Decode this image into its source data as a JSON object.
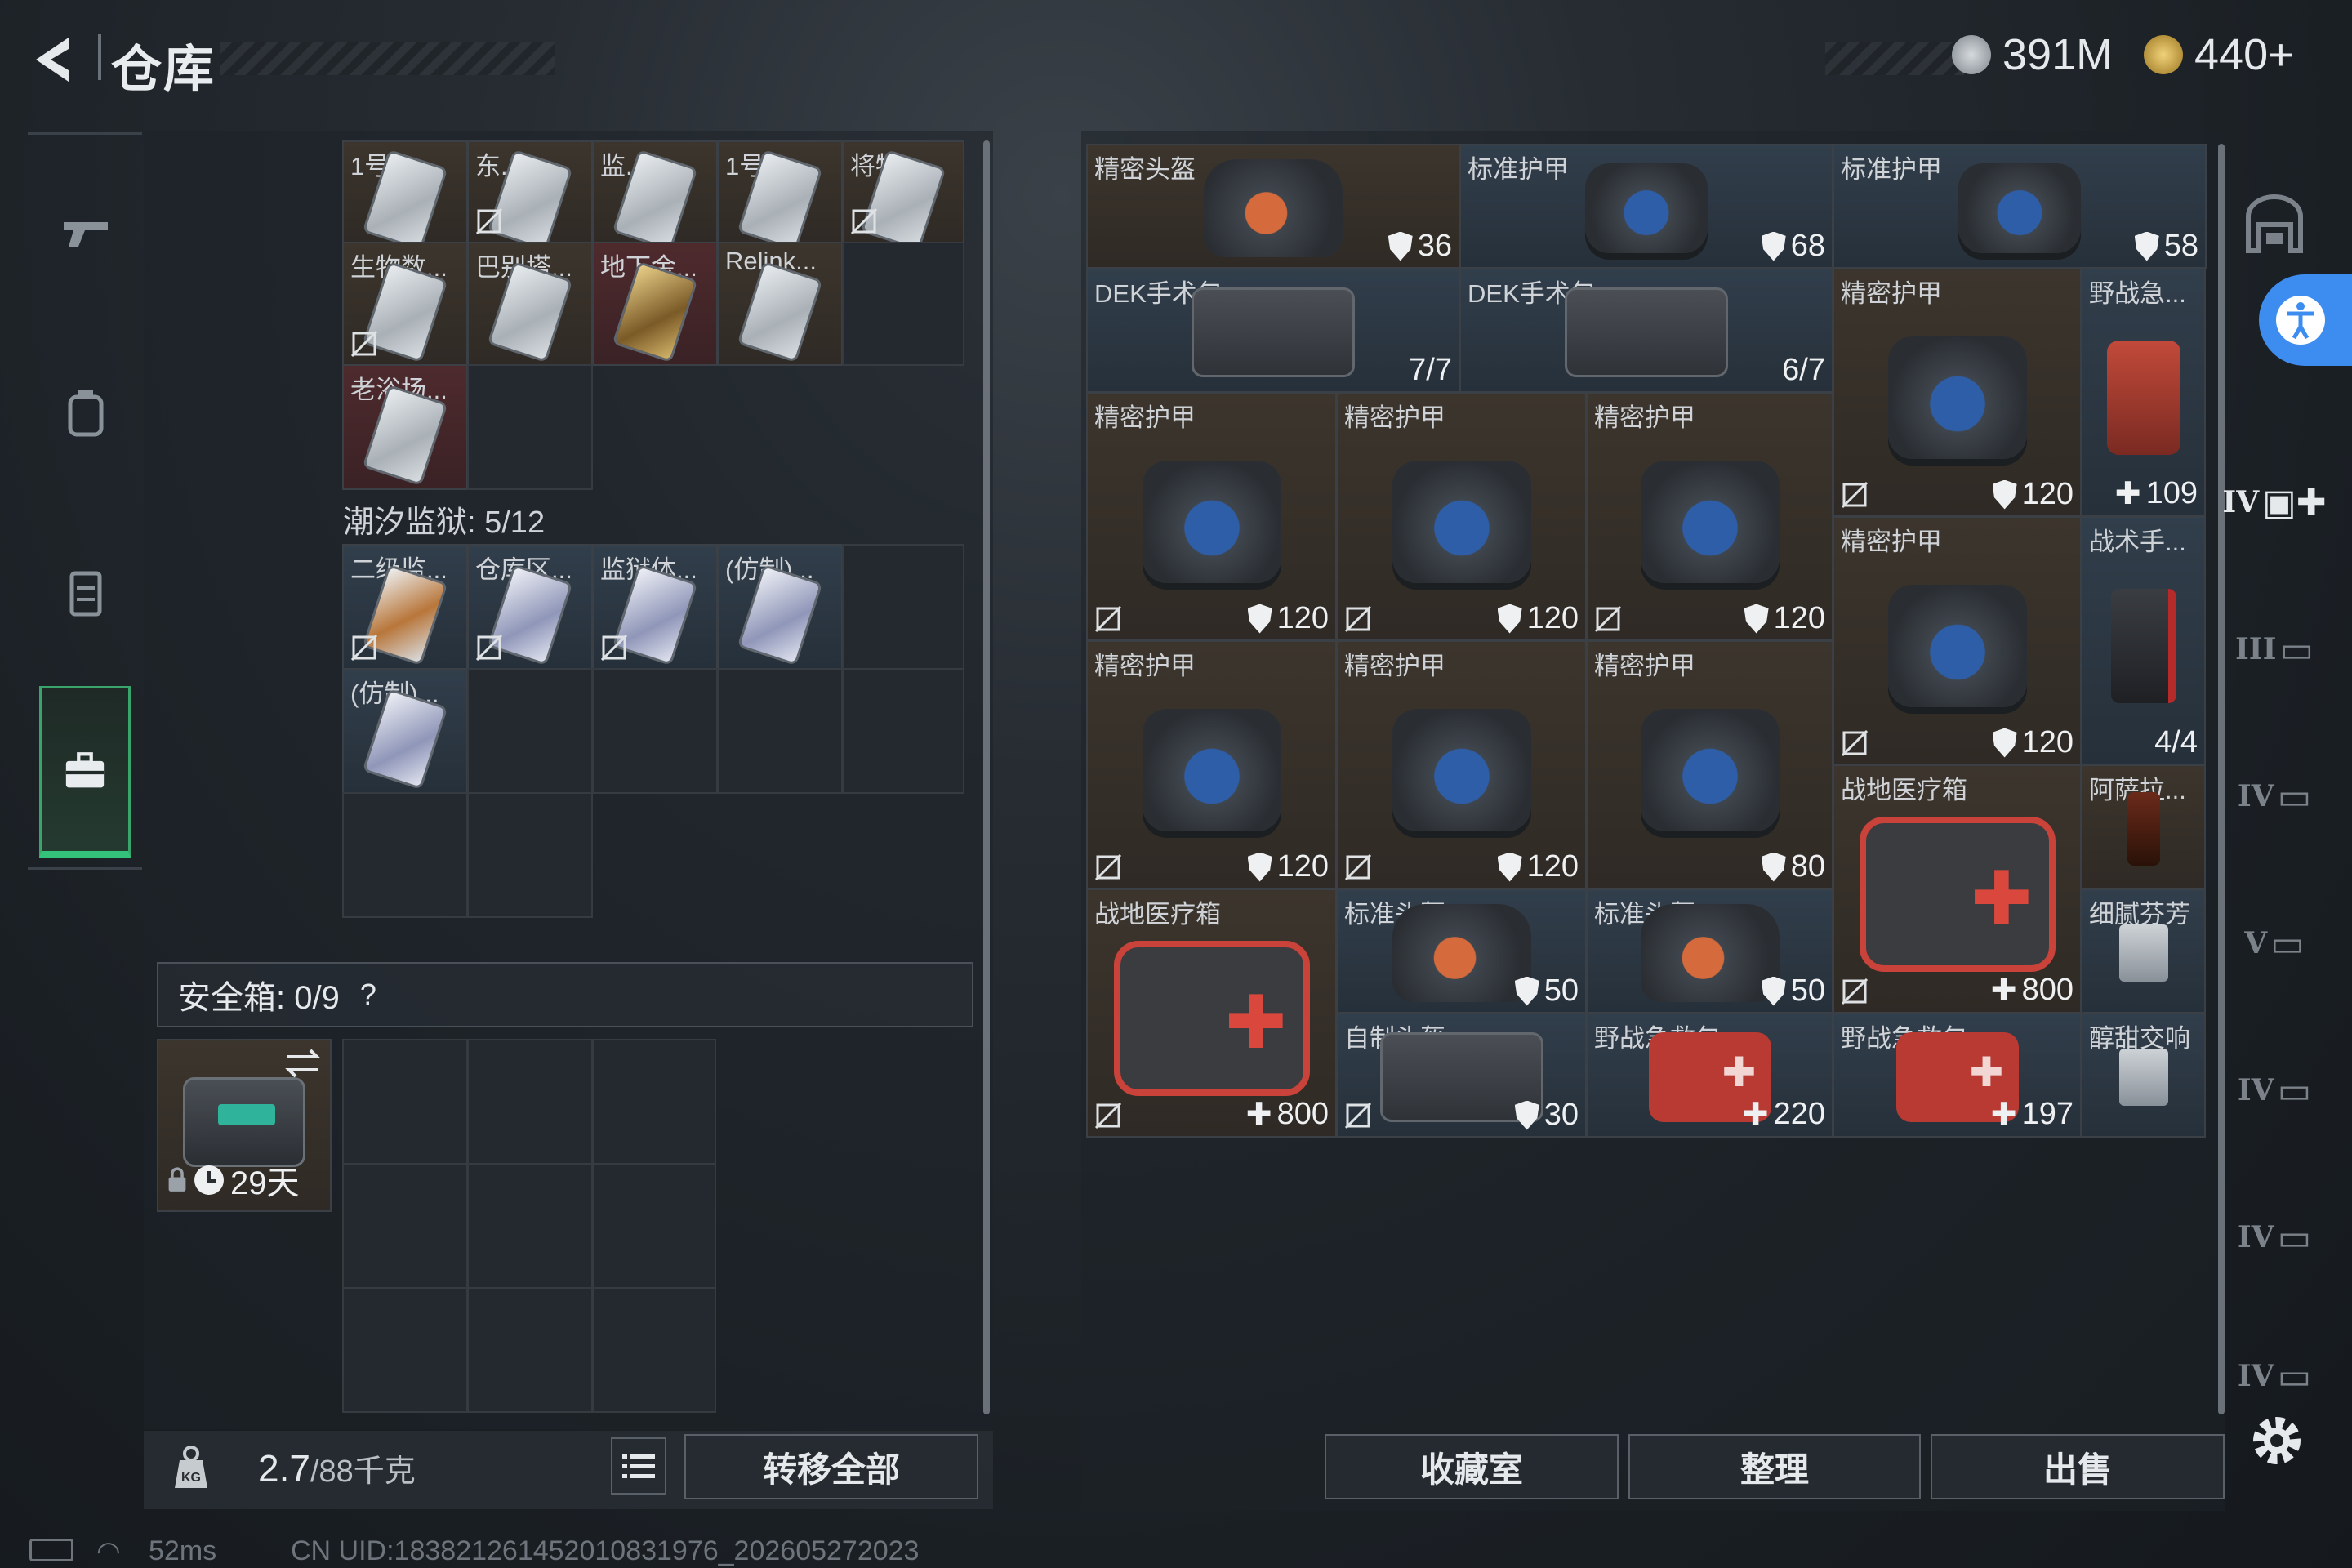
{
  "header": {
    "title": "仓库",
    "currency_silver": "391M",
    "currency_gold": "440+"
  },
  "stash_left": {
    "row1": [
      {
        "name": "1号..."
      },
      {
        "name": "东..."
      },
      {
        "name": "监..."
      },
      {
        "name": "1号..."
      },
      {
        "name": "将物..."
      }
    ],
    "row2": [
      {
        "name": "生物数..."
      },
      {
        "name": "巴别塔..."
      },
      {
        "name": "地下金..."
      },
      {
        "name": "Relink..."
      }
    ],
    "row3": [
      {
        "name": "老浴场..."
      }
    ],
    "section_title": "潮汐监狱: 5/12",
    "row4": [
      {
        "name": "二级监..."
      },
      {
        "name": "仓库区..."
      },
      {
        "name": "监狱体..."
      },
      {
        "name": "(仿制)..."
      }
    ],
    "row5": [
      {
        "name": "(仿制)..."
      }
    ]
  },
  "safebox": {
    "label": "安全箱: 0/9",
    "help": "?",
    "item_timer": "29天"
  },
  "weight": {
    "current": "2.7",
    "max": "/88千克"
  },
  "buttons": {
    "transfer_all": "转移全部",
    "collection": "收藏室",
    "organize": "整理",
    "sell": "出售"
  },
  "grid": [
    {
      "name": "精密头盔",
      "value": "36",
      "kind": "shield"
    },
    {
      "name": "标准护甲",
      "value": "68",
      "kind": "shield"
    },
    {
      "name": "标准护甲",
      "value": "58",
      "kind": "shield"
    },
    {
      "name": "DEK手术包",
      "value": "7/7",
      "kind": "text"
    },
    {
      "name": "DEK手术包",
      "value": "6/7",
      "kind": "text"
    },
    {
      "name": "精密护甲",
      "value": "120",
      "kind": "shield"
    },
    {
      "name": "野战急...",
      "value": "109",
      "kind": "plus"
    },
    {
      "name": "精密护甲",
      "value": "120",
      "kind": "shield"
    },
    {
      "name": "精密护甲",
      "value": "120",
      "kind": "shield"
    },
    {
      "name": "精密护甲",
      "value": "120",
      "kind": "shield"
    },
    {
      "name": "精密护甲",
      "value": "120",
      "kind": "shield"
    },
    {
      "name": "战术手...",
      "value": "4/4",
      "kind": "text"
    },
    {
      "name": "精密护甲",
      "value": "120",
      "kind": "shield"
    },
    {
      "name": "精密护甲",
      "value": "120",
      "kind": "shield"
    },
    {
      "name": "精密护甲",
      "value": "80",
      "kind": "shield"
    },
    {
      "name": "战地医疗箱",
      "value": "800",
      "kind": "plus"
    },
    {
      "name": "阿萨拉...",
      "value": "",
      "kind": "text"
    },
    {
      "name": "战地医疗箱",
      "value": "800",
      "kind": "plus"
    },
    {
      "name": "标准头盔",
      "value": "50",
      "kind": "shield"
    },
    {
      "name": "标准头盔",
      "value": "50",
      "kind": "shield"
    },
    {
      "name": "细腻芬芳",
      "value": "",
      "kind": "text"
    },
    {
      "name": "自制头盔",
      "value": "30",
      "kind": "shield"
    },
    {
      "name": "野战急救包",
      "value": "220",
      "kind": "plus"
    },
    {
      "name": "野战急救包",
      "value": "197",
      "kind": "plus"
    },
    {
      "name": "醇甜交响",
      "value": "",
      "kind": "text"
    }
  ],
  "right_tabs": [
    "IV",
    "IV",
    "III",
    "IV",
    "V",
    "IV",
    "IV",
    "IV"
  ],
  "status": {
    "ping": "52ms",
    "uid": "CN UID:183821261452010831976_202605272023"
  },
  "colors": {
    "accent_green": "#34c27a",
    "cell_brown": "#3c352d",
    "cell_blue": "#313e4b",
    "cell_red": "#4e2a2d"
  }
}
